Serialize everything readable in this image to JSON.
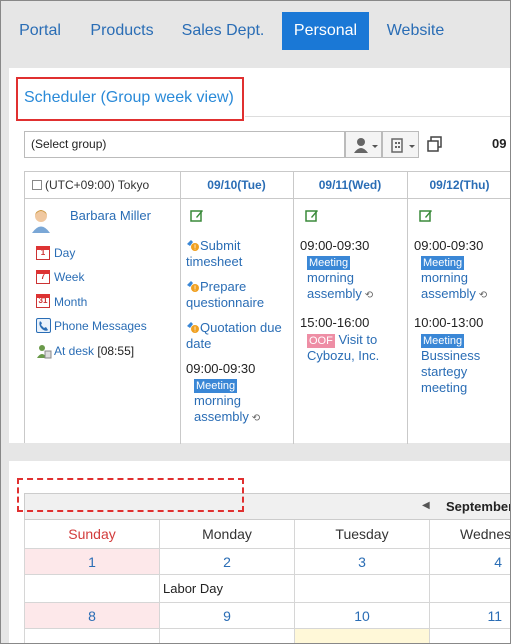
{
  "tabs": [
    {
      "label": "Portal",
      "active": false
    },
    {
      "label": "Products",
      "active": false
    },
    {
      "label": "Sales Dept.",
      "active": false
    },
    {
      "label": "Personal",
      "active": true
    },
    {
      "label": "Website",
      "active": false
    }
  ],
  "scheduler": {
    "title": "Scheduler (Group week view)",
    "group_select": "(Select group)",
    "date_clip": "09",
    "timezone": "(UTC+09:00) Tokyo",
    "days": [
      "09/10(Tue)",
      "09/11(Wed)",
      "09/12(Thu)"
    ],
    "user": {
      "name": "Barbara Miller",
      "links": {
        "day": "Day",
        "week": "Week",
        "month": "Month",
        "phone": "Phone Messages",
        "at_desk": "At desk",
        "at_desk_time": "[08:55]"
      },
      "cal_icon_nums": {
        "day": "1",
        "week": "7",
        "month": "31"
      }
    },
    "col1": {
      "todo1": "Submit timesheet",
      "todo2": "Prepare questionnaire",
      "todo3": "Quotation due date",
      "event_time": "09:00-09:30",
      "event_badge": "Meeting",
      "event_title": "morning assembly"
    },
    "col2": {
      "e1_time": "09:00-09:30",
      "e1_badge": "Meeting",
      "e1_title": "morning assembly",
      "e2_time": "15:00-16:00",
      "e2_badge": "OOF",
      "e2_title_a": "Visit to",
      "e2_title_b": "Cybozu, Inc."
    },
    "col3": {
      "e1_time": "09:00-09:30",
      "e1_badge": "Meeting",
      "e1_title": "morning assembly",
      "e2_time": "10:00-13:00",
      "e2_badge": "Meeting",
      "e2_title": "Bussiness startegy meeting"
    }
  },
  "calendar": {
    "month_title": "September",
    "weekdays": [
      "Sunday",
      "Monday",
      "Tuesday",
      "Wednes"
    ],
    "week1": [
      "1",
      "2",
      "3",
      "4"
    ],
    "holiday": "Labor Day",
    "week2": [
      "8",
      "9",
      "10",
      "11"
    ]
  },
  "colors": {
    "accent": "#1a78d6",
    "link": "#2a6db5",
    "highlight": "#e03030",
    "sunday": "#d23c3c"
  }
}
